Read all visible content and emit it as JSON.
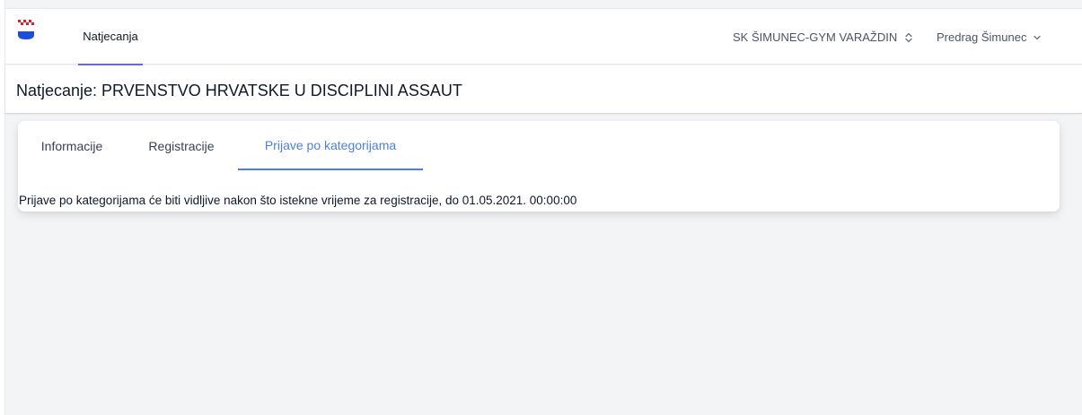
{
  "navbar": {
    "nav_link": "Natjecanja",
    "club_name": "SK ŠIMUNEC-GYM VARAŽDIN",
    "user_name": "Predrag Šimunec",
    "logo_icon": "croatian-coat-of-arms-icon",
    "club_select_icon": "chevron-up-down-icon",
    "user_menu_icon": "chevron-down-icon"
  },
  "header": {
    "title": "Natjecanje: PRVENSTVO HRVATSKE U DISCIPLINI ASSAUT"
  },
  "tabs": [
    {
      "label": "Informacije",
      "active": false
    },
    {
      "label": "Registracije",
      "active": false
    },
    {
      "label": "Prijave po kategorijama",
      "active": true
    }
  ],
  "content": {
    "message": "Prijave po kategorijama će biti vidljive nakon što istekne vrijeme za registracije, do 01.05.2021. 00:00:00"
  },
  "colors": {
    "accent": "#4f7fdc",
    "nav_underline": "#6366f1",
    "background": "#f3f4f6"
  }
}
